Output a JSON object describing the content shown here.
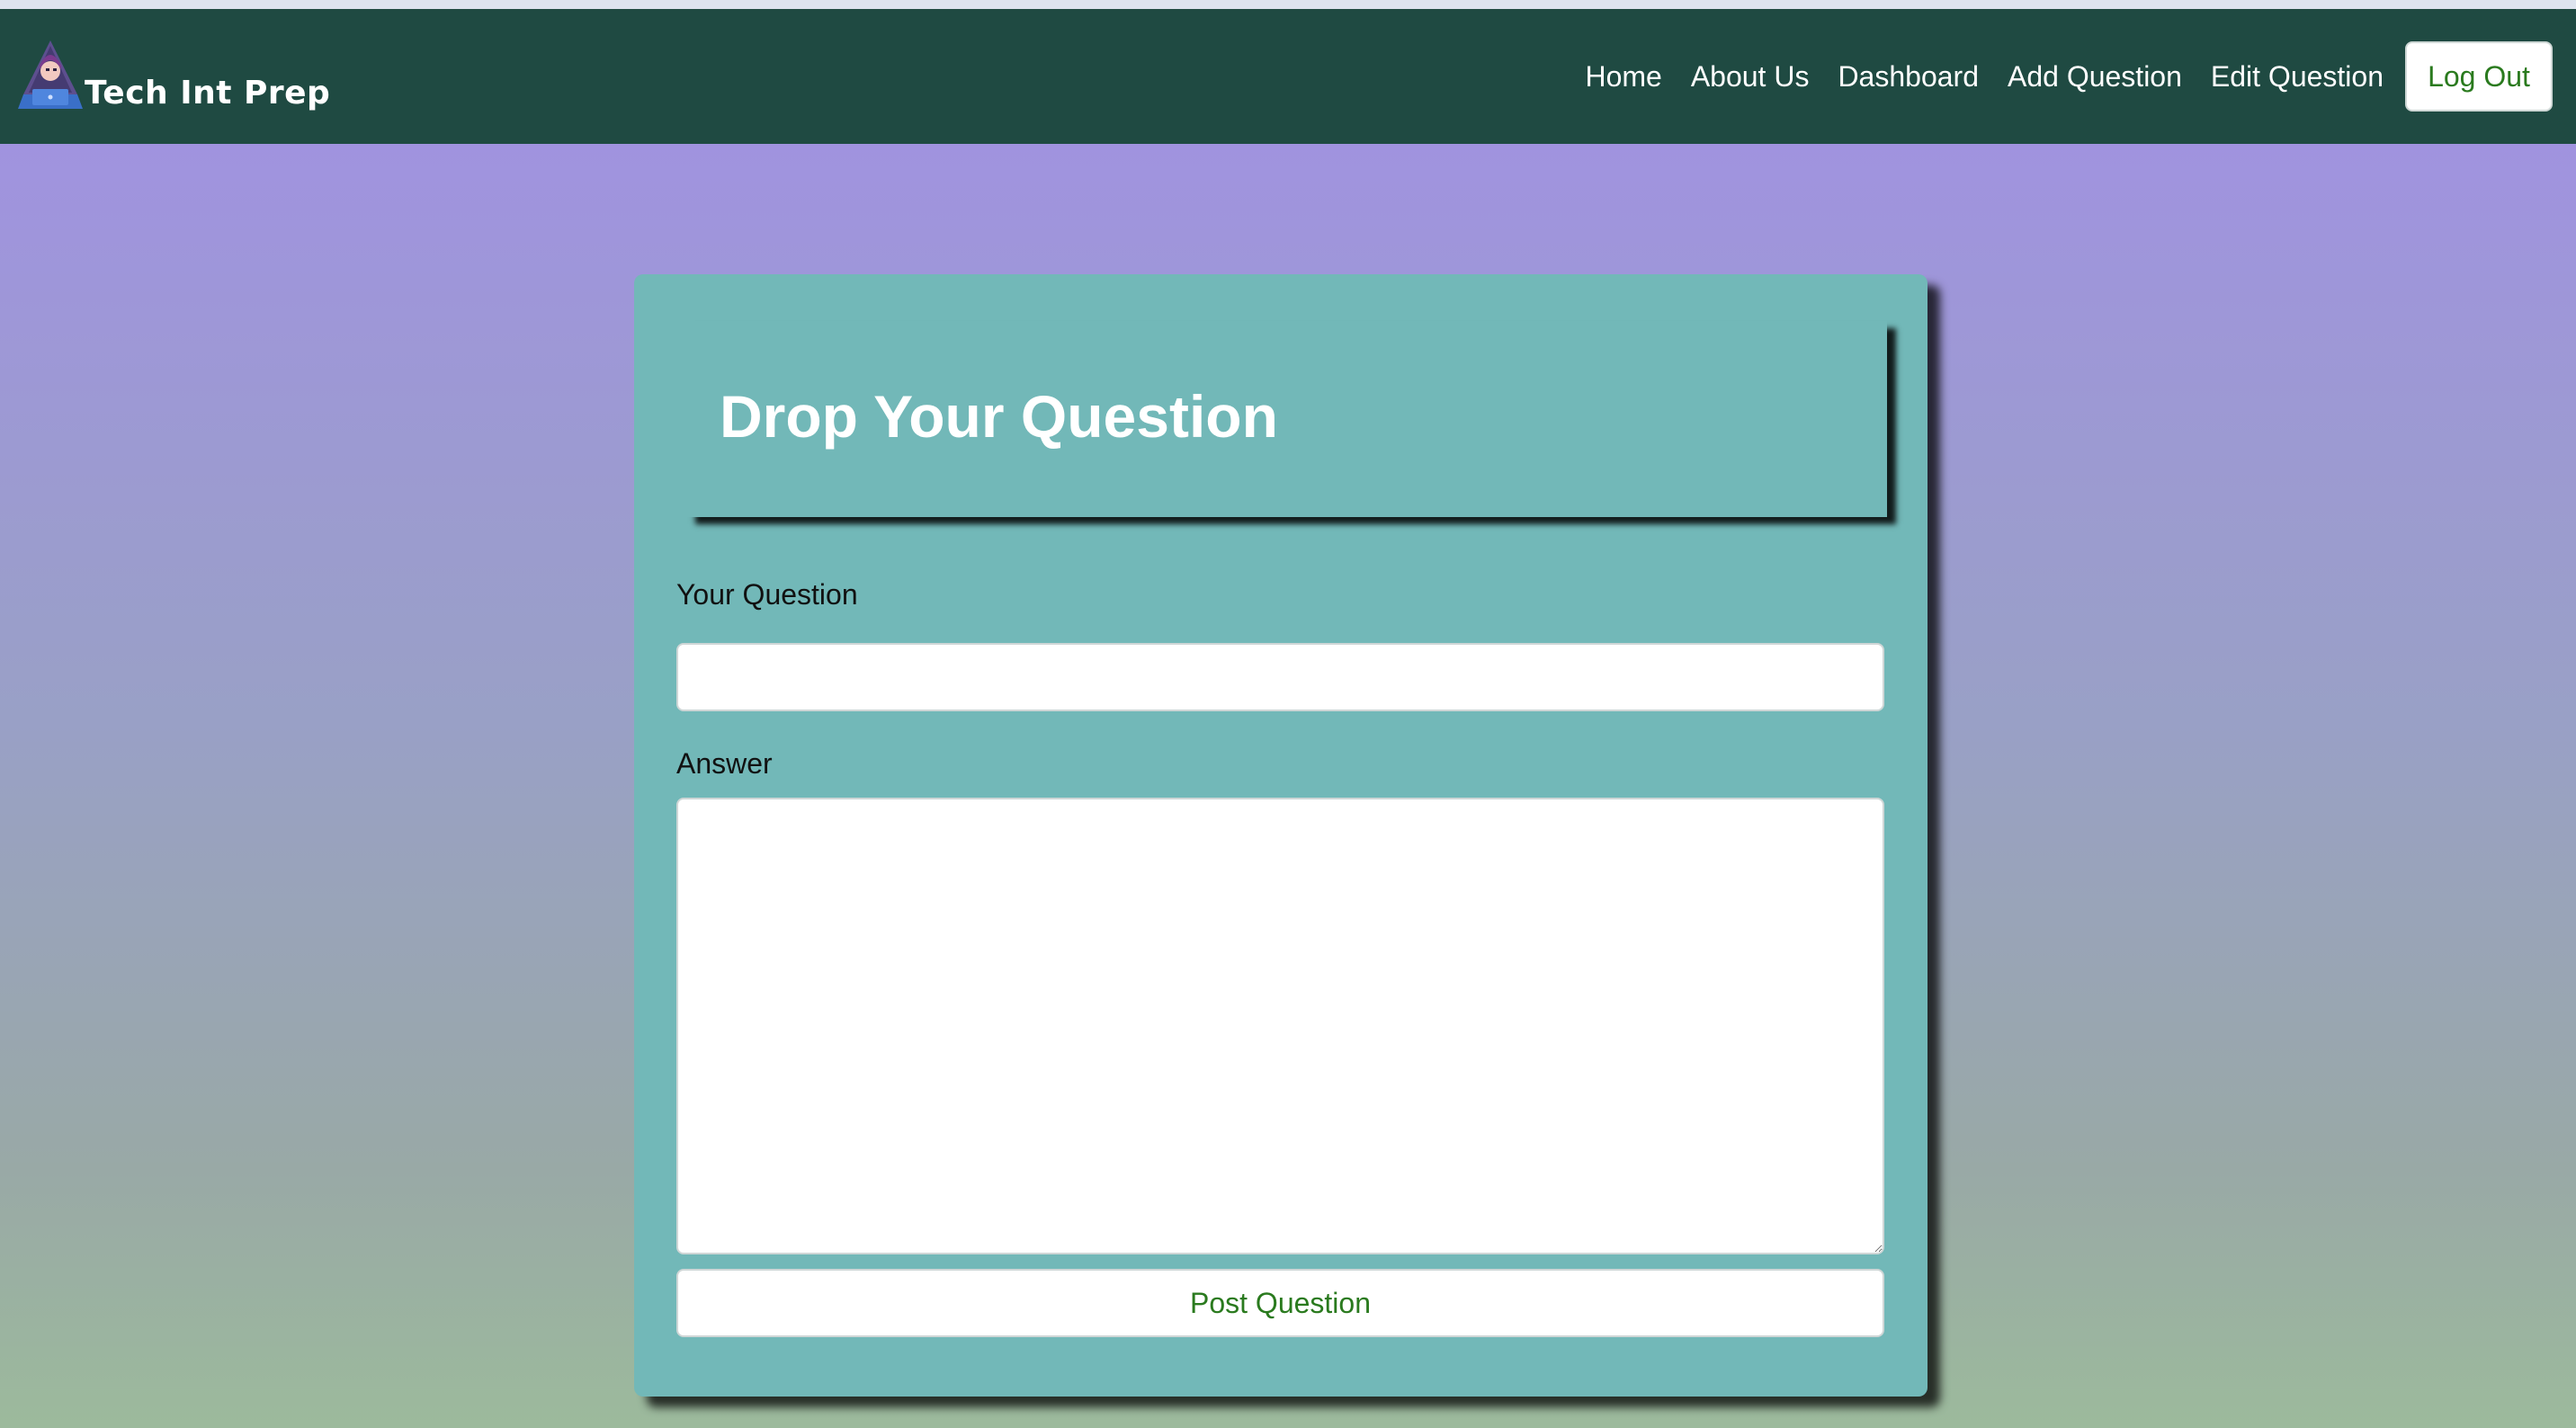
{
  "navbar": {
    "brand_text": "Tech Int Prep",
    "brand_icon": "hooded-hacker-laptop-icon",
    "links": [
      {
        "label": "Home"
      },
      {
        "label": "About Us"
      },
      {
        "label": "Dashboard"
      },
      {
        "label": "Add Question"
      },
      {
        "label": "Edit Question"
      }
    ],
    "logout_label": "Log Out"
  },
  "form": {
    "title": "Drop Your Question",
    "question_label": "Your Question",
    "question_value": "",
    "answer_label": "Answer",
    "answer_value": "",
    "submit_label": "Post Question"
  },
  "colors": {
    "navbar_bg": "#1f4a42",
    "card_bg": "#72b8b8",
    "accent_green": "#2a7a1e",
    "bg_gradient_top": "#a093df",
    "bg_gradient_bottom": "#9cba9c"
  }
}
